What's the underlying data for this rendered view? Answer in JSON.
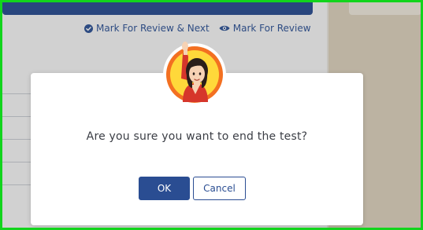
{
  "toolbar": {
    "mark_review_next": "Mark For Review & Next",
    "mark_review": "Mark For Review"
  },
  "dialog": {
    "question": "Are you sure you want to end the test?",
    "ok_label": "OK",
    "cancel_label": "Cancel"
  },
  "icons": {
    "mark_review_next": "check-circle-icon",
    "mark_review": "eye-icon",
    "avatar": "waving-student-avatar"
  },
  "colors": {
    "primary": "#2a4d92",
    "frame": "#12d41c",
    "avatar_ring": "#f37021",
    "avatar_inner": "#ffd83a"
  }
}
